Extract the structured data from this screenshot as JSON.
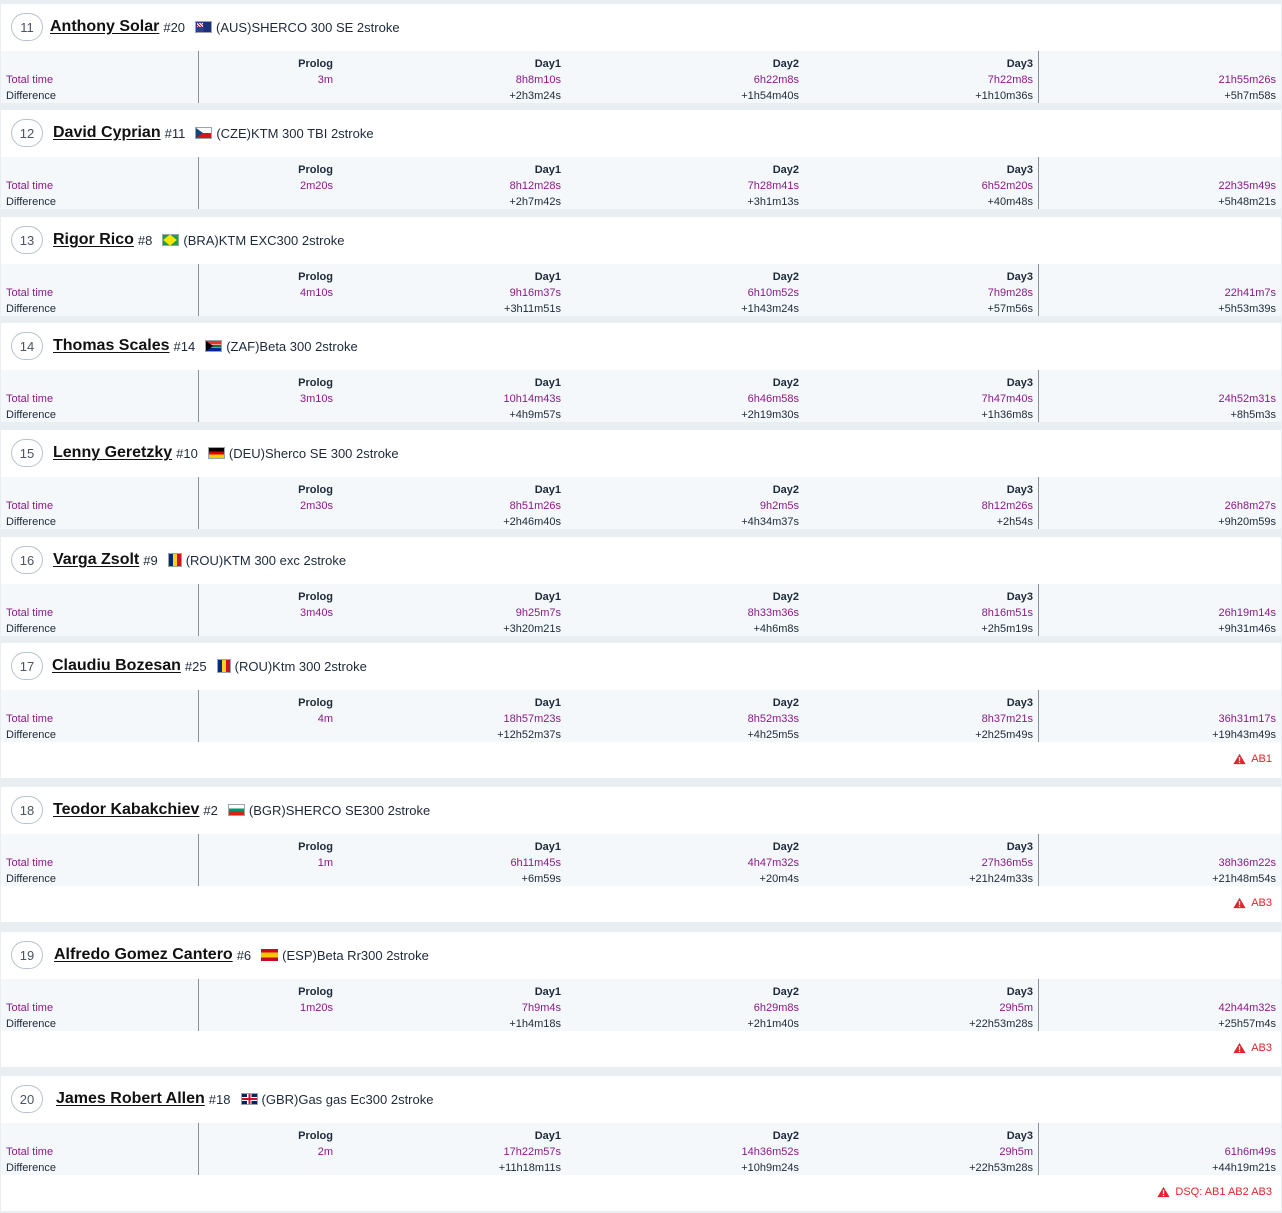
{
  "labels": {
    "total_time": "Total time",
    "difference": "Difference",
    "columns": [
      "Prolog",
      "Day1",
      "Day2",
      "Day3",
      ""
    ]
  },
  "colors": {
    "total_time_value": "#8b1a88",
    "alert": "#e3242b",
    "table_bg": "#f4f8fa"
  },
  "riders": [
    {
      "pos": "11",
      "name": "Anthony Solar",
      "number": "#20",
      "flag": "aus-flag-icon",
      "country": "(AUS)",
      "bike": "SHERCO 300 SE 2stroke",
      "total": [
        "3m",
        "8h8m10s",
        "6h22m8s",
        "7h22m8s",
        "21h55m26s"
      ],
      "diff": [
        "",
        "+2h3m24s",
        "+1h54m40s",
        "+1h10m36s",
        "+5h7m58s"
      ],
      "alert": ""
    },
    {
      "pos": "12",
      "name": "David Cyprian",
      "number": "#11",
      "flag": "cze-flag-icon",
      "country": "(CZE)",
      "bike": "KTM 300 TBI 2stroke",
      "total": [
        "2m20s",
        "8h12m28s",
        "7h28m41s",
        "6h52m20s",
        "22h35m49s"
      ],
      "diff": [
        "",
        "+2h7m42s",
        "+3h1m13s",
        "+40m48s",
        "+5h48m21s"
      ],
      "alert": ""
    },
    {
      "pos": "13",
      "name": "Rigor Rico",
      "number": "#8",
      "flag": "bra-flag-icon",
      "country": "(BRA)",
      "bike": "KTM EXC300 2stroke",
      "total": [
        "4m10s",
        "9h16m37s",
        "6h10m52s",
        "7h9m28s",
        "22h41m7s"
      ],
      "diff": [
        "",
        "+3h11m51s",
        "+1h43m24s",
        "+57m56s",
        "+5h53m39s"
      ],
      "alert": ""
    },
    {
      "pos": "14",
      "name": "Thomas Scales",
      "number": "#14",
      "flag": "zaf-flag-icon",
      "country": "(ZAF)",
      "bike": "Beta 300 2stroke",
      "total": [
        "3m10s",
        "10h14m43s",
        "6h46m58s",
        "7h47m40s",
        "24h52m31s"
      ],
      "diff": [
        "",
        "+4h9m57s",
        "+2h19m30s",
        "+1h36m8s",
        "+8h5m3s"
      ],
      "alert": ""
    },
    {
      "pos": "15",
      "name": "Lenny Geretzky",
      "number": "#10",
      "flag": "deu-flag-icon",
      "country": "(DEU)",
      "bike": "Sherco SE 300 2stroke",
      "total": [
        "2m30s",
        "8h51m26s",
        "9h2m5s",
        "8h12m26s",
        "26h8m27s"
      ],
      "diff": [
        "",
        "+2h46m40s",
        "+4h34m37s",
        "+2h54s",
        "+9h20m59s"
      ],
      "alert": ""
    },
    {
      "pos": "16",
      "name": "Varga Zsolt",
      "number": "#9",
      "flag": "rou-flag-icon",
      "country": "(ROU)",
      "bike": "KTM 300 exc 2stroke",
      "total": [
        "3m40s",
        "9h25m7s",
        "8h33m36s",
        "8h16m51s",
        "26h19m14s"
      ],
      "diff": [
        "",
        "+3h20m21s",
        "+4h6m8s",
        "+2h5m19s",
        "+9h31m46s"
      ],
      "alert": ""
    },
    {
      "pos": "17",
      "name": "Claudiu Bozesan",
      "number": "#25",
      "flag": "rou-flag-icon",
      "country": "(ROU)",
      "bike": "Ktm 300 2stroke",
      "total": [
        "4m",
        "18h57m23s",
        "8h52m33s",
        "8h37m21s",
        "36h31m17s"
      ],
      "diff": [
        "",
        "+12h52m37s",
        "+4h25m5s",
        "+2h25m49s",
        "+19h43m49s"
      ],
      "alert": "AB1"
    },
    {
      "pos": "18",
      "name": "Teodor Kabakchiev",
      "number": "#2",
      "flag": "bgr-flag-icon",
      "country": "(BGR)",
      "bike": "SHERCO SE300 2stroke",
      "total": [
        "1m",
        "6h11m45s",
        "4h47m32s",
        "27h36m5s",
        "38h36m22s"
      ],
      "diff": [
        "",
        "+6m59s",
        "+20m4s",
        "+21h24m33s",
        "+21h48m54s"
      ],
      "alert": "AB3"
    },
    {
      "pos": "19",
      "name": "Alfredo Gomez Cantero",
      "number": "#6",
      "flag": "esp-flag-icon",
      "country": "(ESP)",
      "bike": "Beta Rr300 2stroke",
      "total": [
        "1m20s",
        "7h9m4s",
        "6h29m8s",
        "29h5m",
        "42h44m32s"
      ],
      "diff": [
        "",
        "+1h4m18s",
        "+2h1m40s",
        "+22h53m28s",
        "+25h57m4s"
      ],
      "alert": "AB3"
    },
    {
      "pos": "20",
      "name": "James Robert Allen",
      "number": "#18",
      "flag": "gbr-flag-icon",
      "country": "(GBR)",
      "bike": "Gas gas Ec300 2stroke",
      "total": [
        "2m",
        "17h22m57s",
        "14h36m52s",
        "29h5m",
        "61h6m49s"
      ],
      "diff": [
        "",
        "+11h18m11s",
        "+10h9m24s",
        "+22h53m28s",
        "+44h19m21s"
      ],
      "alert": "DSQ: AB1 AB2 AB3"
    }
  ]
}
